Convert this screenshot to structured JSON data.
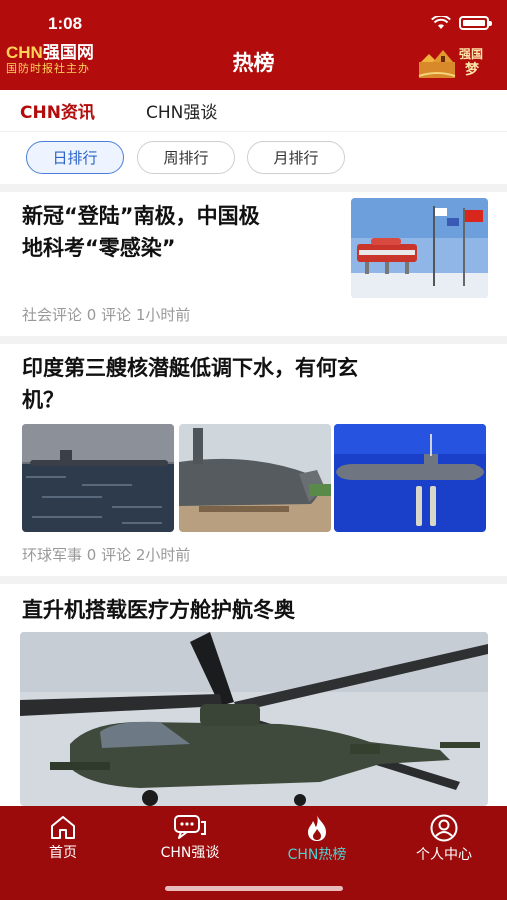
{
  "status": {
    "time": "1:08"
  },
  "header": {
    "brand_name_prefix": "CHN",
    "brand_name_suffix": "强国网",
    "brand_sub": "国防时报社主办",
    "title": "热榜",
    "dream_logo_text": "强国梦"
  },
  "tabs": [
    {
      "label": "CHN资讯",
      "active": true
    },
    {
      "label": "CHN强谈",
      "active": false
    }
  ],
  "filters": [
    {
      "label": "日排行",
      "selected": true
    },
    {
      "label": "周排行",
      "selected": false
    },
    {
      "label": "月排行",
      "selected": false
    }
  ],
  "articles": [
    {
      "title_line1": "新冠“登陆”南极，中国极",
      "title_line2": "地科考“零感染”",
      "meta": "社会评论  0 评论  1小时前"
    },
    {
      "title_line1": "印度第三艘核潜艇低调下水，有何玄",
      "title_line2": "机？",
      "meta": "环球军事  0 评论  2小时前"
    },
    {
      "title_line1": "直升机搭载医疗方舱护航冬奥",
      "title_line2": ""
    }
  ],
  "bottom_nav": [
    {
      "label": "首页",
      "icon": "home-icon",
      "active": false
    },
    {
      "label": "CHN强谈",
      "icon": "chat-icon",
      "active": false
    },
    {
      "label": "CHN热榜",
      "icon": "flame-icon",
      "active": true
    },
    {
      "label": "个人中心",
      "icon": "user-icon",
      "active": false
    }
  ],
  "colors": {
    "brand_red": "#b30c0c",
    "nav_red": "#9b0b0b",
    "active_nav": "#4fd1d1",
    "pill_blue": "#2a63c8"
  }
}
